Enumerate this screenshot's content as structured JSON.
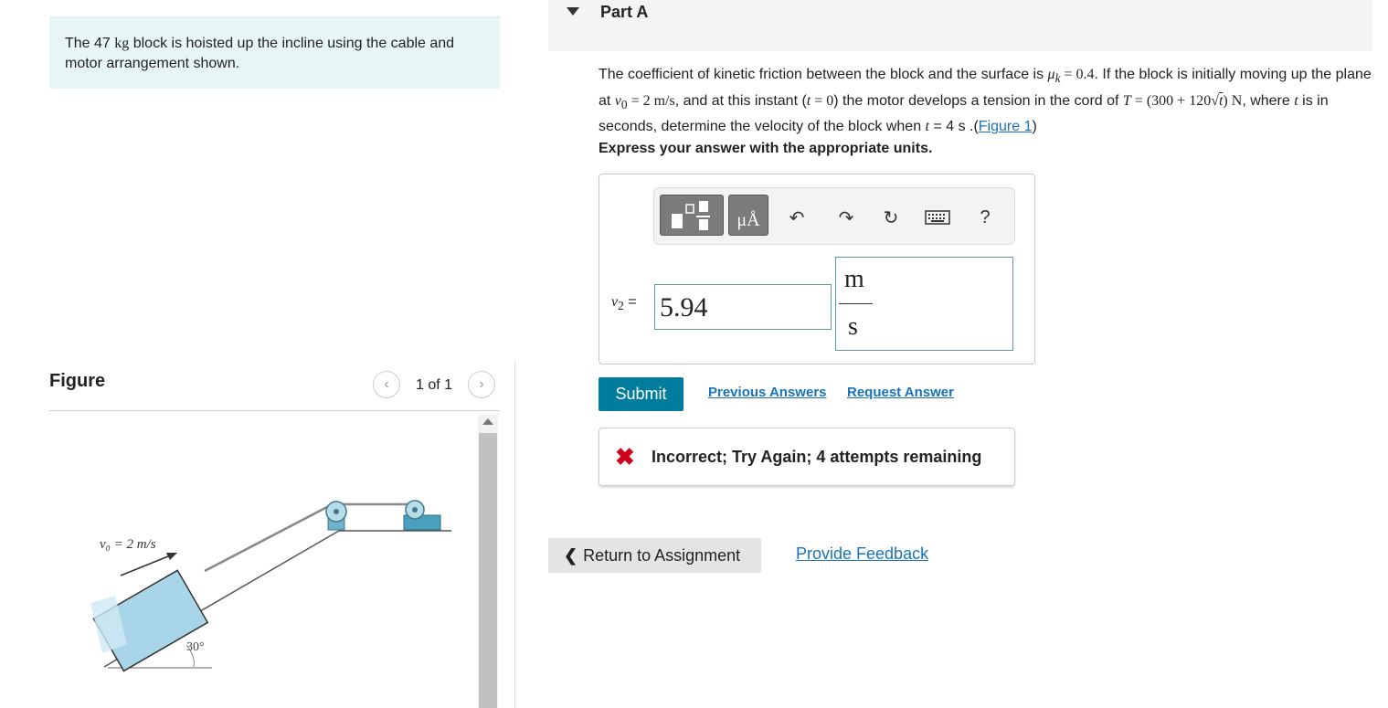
{
  "intro": {
    "text_before": "The 47 ",
    "unit": "kg",
    "text_after": " block is hoisted up the incline using the cable and motor arrangement shown."
  },
  "figure": {
    "title": "Figure",
    "counter": "1 of 1",
    "prev_icon": "‹",
    "next_icon": "›",
    "velocity_label": "v₀ = 2 m/s",
    "angle_label": "30°"
  },
  "part": {
    "title": "Part A"
  },
  "question": {
    "s1": "The coefficient of kinetic friction between the block and the surface is ",
    "mu": "μ",
    "mu_sub": "k",
    "mu_val": " = 0.4",
    "s2": ". If the block is initially moving up the plane at ",
    "v0": "v",
    "v0_sub": "0",
    "v0_val": " = 2 m/s",
    "s3": ", and at this instant (",
    "t1": "t",
    "t1_val": " = 0",
    "s4": ") the motor develops a tension in the cord of ",
    "T": "T",
    "T_val1": " = (300 + 120√",
    "T_t": "t",
    "T_val2": ") N",
    "s5": ", where ",
    "t2": "t",
    "s6": " is in seconds, determine the velocity of the block when ",
    "t3": "t",
    "s7": " = 4 s .(",
    "link": "Figure 1",
    "s8": ")"
  },
  "express": "Express your answer with the appropriate units.",
  "toolbar": {
    "units_label": "μÅ",
    "undo_icon": "↶",
    "redo_icon": "↷",
    "reset_icon": "↻",
    "help_label": "?"
  },
  "answer": {
    "var_label": "v",
    "var_sub": "2",
    "eq": " =",
    "value": "5.94",
    "unit_num": "m",
    "unit_den": "s"
  },
  "actions": {
    "submit": "Submit",
    "previous_answers": "Previous Answers",
    "request_answer": "Request Answer"
  },
  "feedback": {
    "icon": "✖",
    "text": "Incorrect; Try Again; 4 attempts remaining"
  },
  "footer": {
    "return_chevron": "❮",
    "return_label": "Return to Assignment",
    "provide_feedback": "Provide Feedback"
  },
  "colors": {
    "accent": "#007c9e",
    "link": "#1a73b8",
    "error": "#d0021b",
    "intro_bg": "#e7f5f5"
  }
}
